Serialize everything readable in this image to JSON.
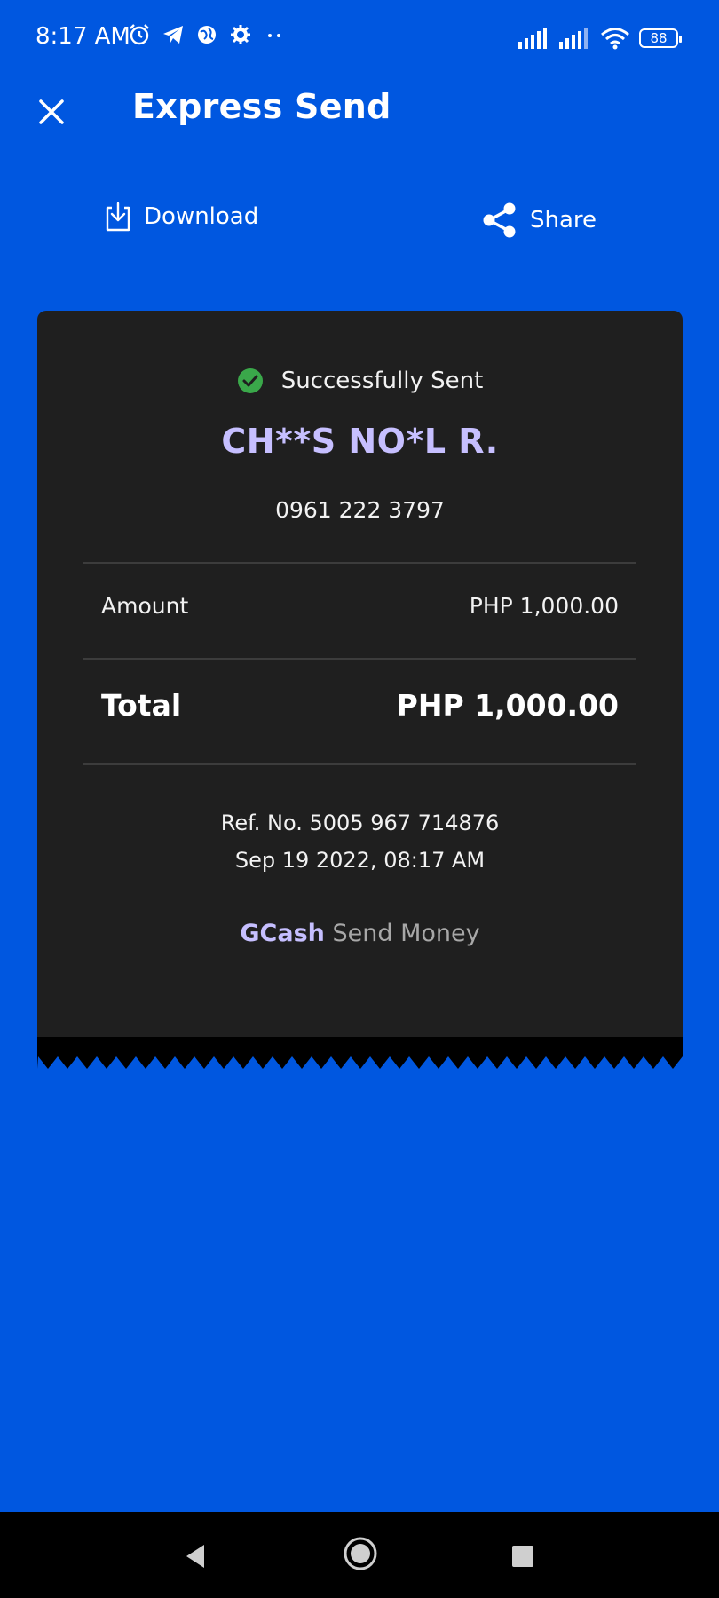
{
  "status_bar": {
    "time": "8:17 AM",
    "battery": "88",
    "icons": [
      "alarm-icon",
      "telegram-icon",
      "globe-icon",
      "settings-icon",
      "more-dots-icon",
      "signal-icon",
      "signal-icon",
      "wifi-icon",
      "battery-icon"
    ]
  },
  "header": {
    "title": "Express Send",
    "close_icon": "close-icon"
  },
  "actions": {
    "download_label": "Download",
    "share_label": "Share"
  },
  "receipt": {
    "status": "Successfully Sent",
    "recipient_name": "CH**S NO*L R.",
    "recipient_phone": "0961 222 3797",
    "amount_label": "Amount",
    "amount_value": "PHP 1,000.00",
    "total_label": "Total",
    "total_value": "PHP 1,000.00",
    "ref_no": "Ref. No. 5005 967 714876",
    "datetime": "Sep 19 2022, 08:17 AM",
    "brand": "GCash",
    "service": "Send Money"
  },
  "colors": {
    "background": "#0057e0",
    "card": "#1f1f1f",
    "accent": "#c6bfff",
    "success": "#3aa84a"
  }
}
